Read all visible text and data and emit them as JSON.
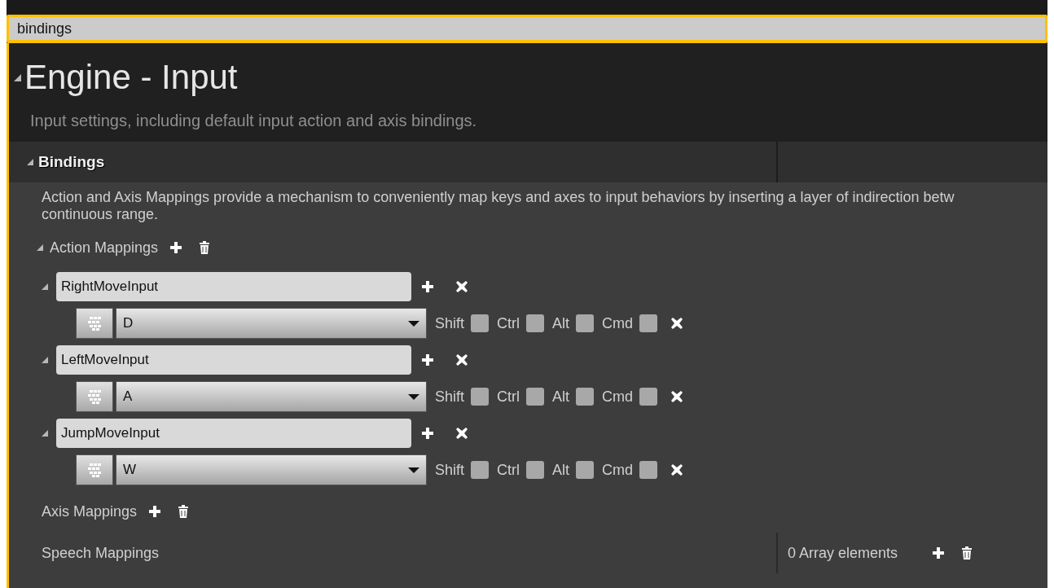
{
  "search": {
    "value": "bindings"
  },
  "category": {
    "title": "Engine - Input",
    "expanded": true,
    "description": "Input settings, including default input action and axis bindings."
  },
  "section": {
    "title": "Bindings",
    "expanded": true,
    "description_lines": [
      "Action and Axis Mappings provide a mechanism to conveniently map keys and axes to input behaviors by inserting a layer of indirection betw",
      "continuous range."
    ]
  },
  "action_mappings": {
    "label": "Action Mappings",
    "expanded": true,
    "items": [
      {
        "name": "RightMoveInput",
        "expanded": true,
        "key": "D",
        "modifiers": [
          {
            "label": "Shift",
            "checked": false
          },
          {
            "label": "Ctrl",
            "checked": false
          },
          {
            "label": "Alt",
            "checked": false
          },
          {
            "label": "Cmd",
            "checked": false
          }
        ]
      },
      {
        "name": "LeftMoveInput",
        "expanded": true,
        "key": "A",
        "modifiers": [
          {
            "label": "Shift",
            "checked": false
          },
          {
            "label": "Ctrl",
            "checked": false
          },
          {
            "label": "Alt",
            "checked": false
          },
          {
            "label": "Cmd",
            "checked": false
          }
        ]
      },
      {
        "name": "JumpMoveInput",
        "expanded": true,
        "key": "W",
        "modifiers": [
          {
            "label": "Shift",
            "checked": false
          },
          {
            "label": "Ctrl",
            "checked": false
          },
          {
            "label": "Alt",
            "checked": false
          },
          {
            "label": "Cmd",
            "checked": false
          }
        ]
      }
    ]
  },
  "axis_mappings": {
    "label": "Axis Mappings"
  },
  "speech_mappings": {
    "label": "Speech Mappings",
    "count": "0 Array elements"
  }
}
